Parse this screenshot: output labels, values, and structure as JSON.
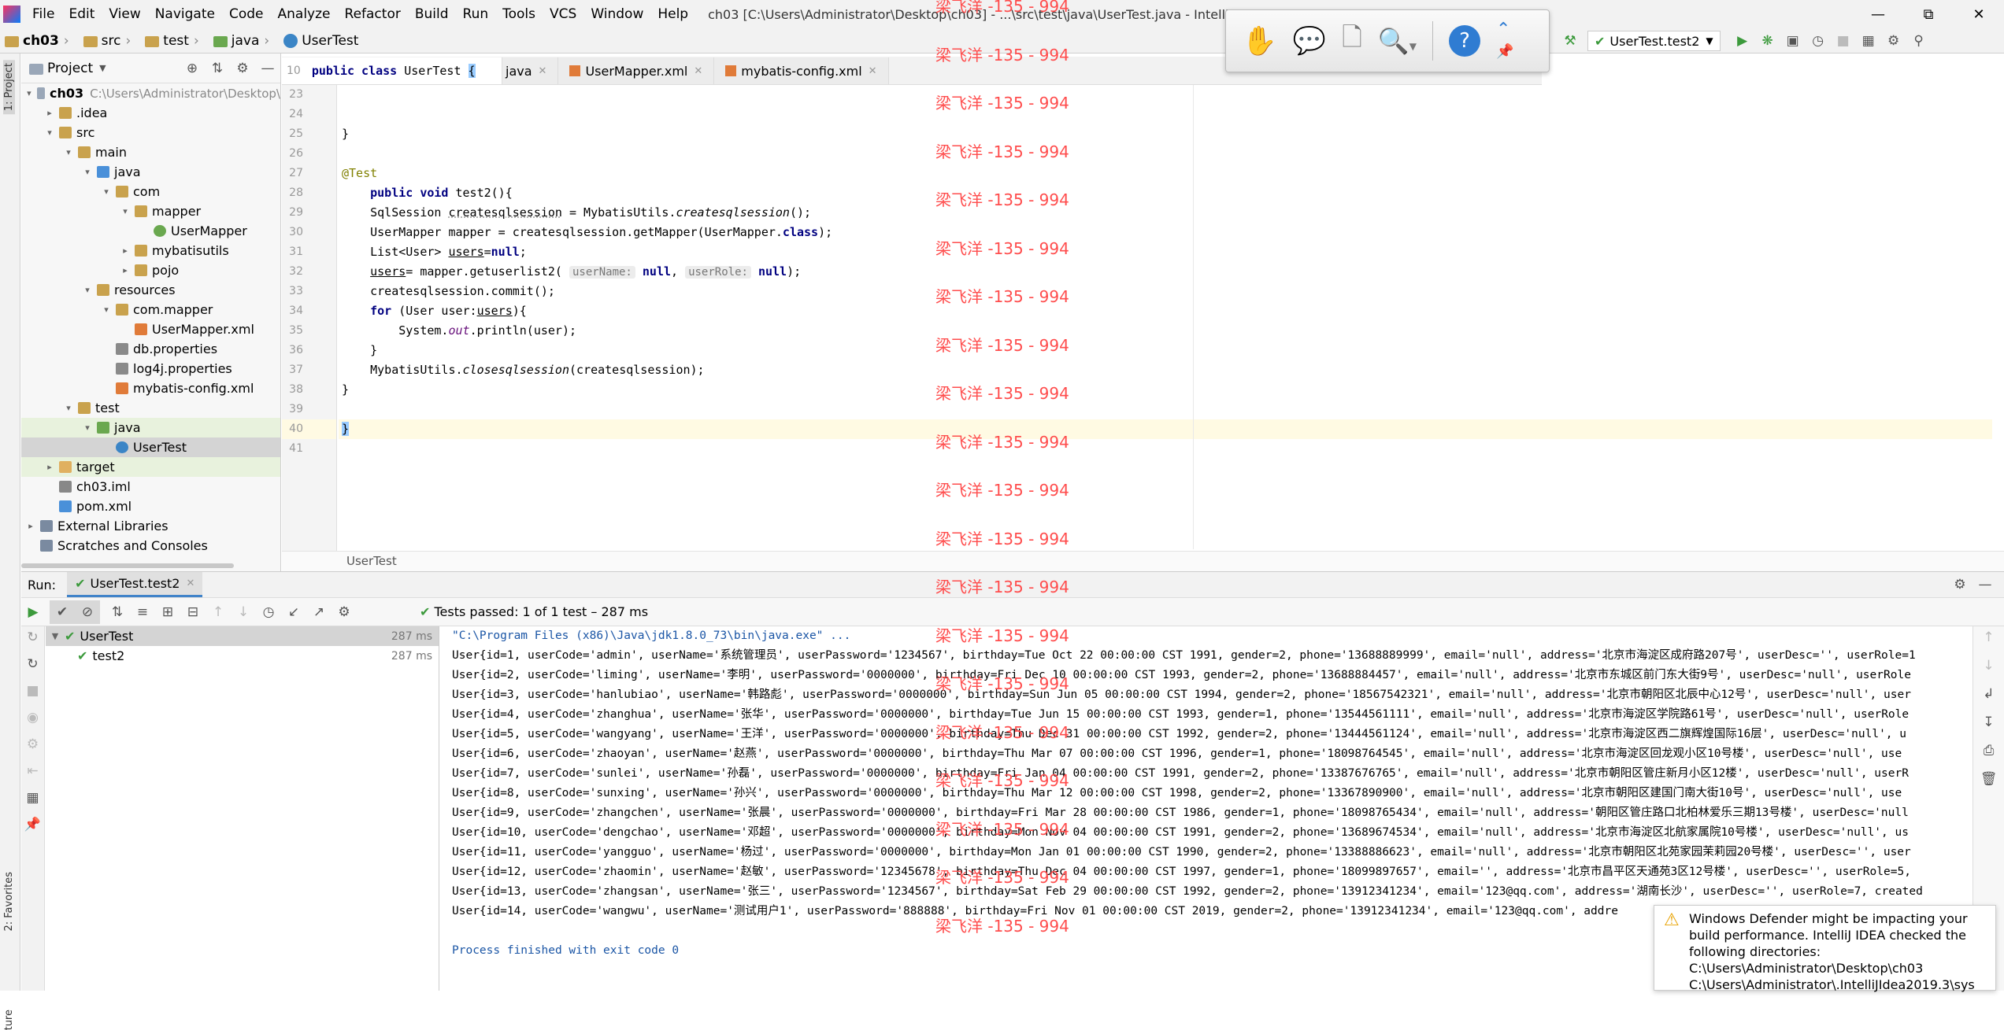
{
  "menubar": {
    "items": [
      "File",
      "Edit",
      "View",
      "Navigate",
      "Code",
      "Analyze",
      "Refactor",
      "Build",
      "Run",
      "Tools",
      "VCS",
      "Window",
      "Help"
    ],
    "title": "ch03 [C:\\Users\\Administrator\\Desktop\\ch03] - ...\\src\\test\\java\\UserTest.java - IntelliJ IDEA (Administrator)"
  },
  "navbar": {
    "crumbs": [
      "ch03",
      "src",
      "test",
      "java",
      "UserTest"
    ]
  },
  "runconfig": {
    "name": "UserTest.test2"
  },
  "project": {
    "header": "Project",
    "tree": [
      {
        "label": "ch03",
        "extra": "C:\\Users\\Administrator\\Desktop\\",
        "depth": 0,
        "open": "down",
        "kind": "module"
      },
      {
        "label": ".idea",
        "depth": 1,
        "open": "right",
        "kind": "folder"
      },
      {
        "label": "src",
        "depth": 1,
        "open": "down",
        "kind": "folder"
      },
      {
        "label": "main",
        "depth": 2,
        "open": "down",
        "kind": "folder"
      },
      {
        "label": "java",
        "depth": 3,
        "open": "down",
        "kind": "src"
      },
      {
        "label": "com",
        "depth": 4,
        "open": "down",
        "kind": "folder"
      },
      {
        "label": "mapper",
        "depth": 5,
        "open": "down",
        "kind": "folder"
      },
      {
        "label": "UserMapper",
        "depth": 6,
        "open": "",
        "kind": "iface"
      },
      {
        "label": "mybatisutils",
        "depth": 5,
        "open": "right",
        "kind": "folder"
      },
      {
        "label": "pojo",
        "depth": 5,
        "open": "right",
        "kind": "folder"
      },
      {
        "label": "resources",
        "depth": 3,
        "open": "down",
        "kind": "res"
      },
      {
        "label": "com.mapper",
        "depth": 4,
        "open": "down",
        "kind": "folder"
      },
      {
        "label": "UserMapper.xml",
        "depth": 5,
        "open": "",
        "kind": "xml"
      },
      {
        "label": "db.properties",
        "depth": 4,
        "open": "",
        "kind": "prop"
      },
      {
        "label": "log4j.properties",
        "depth": 4,
        "open": "",
        "kind": "prop"
      },
      {
        "label": "mybatis-config.xml",
        "depth": 4,
        "open": "",
        "kind": "xml"
      },
      {
        "label": "test",
        "depth": 2,
        "open": "down",
        "kind": "folder"
      },
      {
        "label": "java",
        "depth": 3,
        "open": "down",
        "kind": "testsrc",
        "hl": true
      },
      {
        "label": "UserTest",
        "depth": 4,
        "open": "",
        "kind": "class",
        "sel": true
      },
      {
        "label": "target",
        "depth": 1,
        "open": "right",
        "kind": "target",
        "hl": true
      },
      {
        "label": "ch03.iml",
        "depth": 1,
        "open": "",
        "kind": "iml"
      },
      {
        "label": "pom.xml",
        "depth": 1,
        "open": "",
        "kind": "pom"
      },
      {
        "label": "External Libraries",
        "depth": 0,
        "open": "right",
        "kind": "lib"
      },
      {
        "label": "Scratches and Consoles",
        "depth": 0,
        "open": "",
        "kind": "scratch"
      }
    ]
  },
  "editor": {
    "tabs": [
      {
        "label": "java",
        "active": false
      },
      {
        "label": "UserMapper.xml",
        "active": false
      },
      {
        "label": "mybatis-config.xml",
        "active": false
      }
    ],
    "sticky": {
      "line": "10",
      "text": "public class UserTest {"
    },
    "lines": [
      "23",
      "24",
      "25",
      "26",
      "27",
      "28",
      "29",
      "30",
      "31",
      "32",
      "33",
      "34",
      "35",
      "36",
      "37",
      "38",
      "39",
      "40",
      "41"
    ],
    "code": {
      "l25": "}",
      "l27": "@Test",
      "l28_kw": "public void",
      "l28": " test2(){",
      "l29a": "SqlSession ",
      "l29b": "createsqlsession",
      "l29c": " = MybatisUtils.",
      "l29d": "createsqlsession",
      "l29e": "();",
      "l30a": "UserMapper mapper = createsqlsession.getMapper(UserMapper.",
      "l30kw": "class",
      "l30b": ");",
      "l31a": "List<User> ",
      "l31b": "users",
      "l31c": "=",
      "l31kw": "null",
      "l31d": ";",
      "l32a": "users",
      "l32b": "= mapper.getuserlist2(",
      "l32h1": "userName:",
      "l32n1": "null",
      "l32c": ", ",
      "l32h2": "userRole:",
      "l32n2": "null",
      "l32d": ");",
      "l33": "createsqlsession.commit();",
      "l34kw": "for",
      "l34a": " (User user:",
      "l34b": "users",
      "l34c": "){",
      "l35a": "System.",
      "l35b": "out",
      "l35c": ".println(user);",
      "l36": "}",
      "l37a": "MybatisUtils.",
      "l37b": "closesqlsession",
      "l37c": "(createsqlsession);",
      "l38": "}",
      "l40": "}"
    },
    "breadcrumb": "UserTest"
  },
  "run": {
    "label": "Run:",
    "tab": "UserTest.test2",
    "status": "Tests passed: 1 of 1 test – 287 ms",
    "tree": [
      {
        "label": "UserTest",
        "time": "287 ms"
      },
      {
        "label": "test2",
        "time": "287 ms"
      }
    ],
    "console": [
      "\"C:\\Program Files (x86)\\Java\\jdk1.8.0_73\\bin\\java.exe\" ...",
      "User{id=1, userCode='admin', userName='系统管理员', userPassword='1234567', birthday=Tue Oct 22 00:00:00 CST 1991, gender=2, phone='13688889999', email='null', address='北京市海淀区成府路207号', userDesc='', userRole=1",
      "User{id=2, userCode='liming', userName='李明', userPassword='0000000', birthday=Fri Dec 10 00:00:00 CST 1993, gender=2, phone='13688884457', email='null', address='北京市东城区前门东大街9号', userDesc='null', userRole",
      "User{id=3, userCode='hanlubiao', userName='韩路彪', userPassword='0000000', birthday=Sun Jun 05 00:00:00 CST 1994, gender=2, phone='18567542321', email='null', address='北京市朝阳区北辰中心12号', userDesc='null', user",
      "User{id=4, userCode='zhanghua', userName='张华', userPassword='0000000', birthday=Tue Jun 15 00:00:00 CST 1993, gender=1, phone='13544561111', email='null', address='北京市海淀区学院路61号', userDesc='null', userRole",
      "User{id=5, userCode='wangyang', userName='王洋', userPassword='0000000', birthday=Thu Dec 31 00:00:00 CST 1992, gender=2, phone='13444561124', email='null', address='北京市海淀区西二旗辉煌国际16层', userDesc='null', u",
      "User{id=6, userCode='zhaoyan', userName='赵燕', userPassword='0000000', birthday=Thu Mar 07 00:00:00 CST 1996, gender=1, phone='18098764545', email='null', address='北京市海淀区回龙观小区10号楼', userDesc='null', use",
      "User{id=7, userCode='sunlei', userName='孙磊', userPassword='0000000', birthday=Fri Jan 04 00:00:00 CST 1991, gender=2, phone='13387676765', email='null', address='北京市朝阳区管庄新月小区12楼', userDesc='null', userR",
      "User{id=8, userCode='sunxing', userName='孙兴', userPassword='0000000', birthday=Thu Mar 12 00:00:00 CST 1998, gender=2, phone='13367890900', email='null', address='北京市朝阳区建国门南大街10号', userDesc='null', use",
      "User{id=9, userCode='zhangchen', userName='张晨', userPassword='0000000', birthday=Fri Mar 28 00:00:00 CST 1986, gender=1, phone='18098765434', email='null', address='朝阳区管庄路口北柏林爱乐三期13号楼', userDesc='null",
      "User{id=10, userCode='dengchao', userName='邓超', userPassword='0000000', birthday=Mon Nov 04 00:00:00 CST 1991, gender=2, phone='13689674534', email='null', address='北京市海淀区北航家属院10号楼', userDesc='null', us",
      "User{id=11, userCode='yangguo', userName='杨过', userPassword='0000000', birthday=Mon Jan 01 00:00:00 CST 1990, gender=2, phone='13388886623', email='null', address='北京市朝阳区北苑家园茉莉园20号楼', userDesc='', user",
      "User{id=12, userCode='zhaomin', userName='赵敏', userPassword='12345678', birthday=Thu Dec 04 00:00:00 CST 1997, gender=1, phone='18099897657', email='', address='北京市昌平区天通苑3区12号楼', userDesc='', userRole=5,",
      "User{id=13, userCode='zhangsan', userName='张三', userPassword='1234567', birthday=Sat Feb 29 00:00:00 CST 1992, gender=2, phone='13912341234', email='123@qq.com', address='湖南长沙', userDesc='', userRole=7, created",
      "User{id=14, userCode='wangwu', userName='测试用户1', userPassword='888888', birthday=Fri Nov 01 00:00:00 CST 2019, gender=2, phone='13912341234', email='123@qq.com', addre",
      "",
      "Process finished with exit code 0"
    ]
  },
  "notification": {
    "text": "Windows Defender might be impacting your build performance. IntelliJ IDEA checked the following directories:",
    "dirs": [
      "C:\\Users\\Administrator\\Desktop\\ch03",
      "C:\\Users\\Administrator\\.IntelliJIdea2019.3\\sys"
    ]
  },
  "watermark": {
    "text": "梁飞洋 -135 - 994",
    "count": 20
  },
  "leftstrip": {
    "project": "1: Project",
    "favorites": "2: Favorites",
    "structure": "ture"
  },
  "colors": {
    "accent": "#3c9a3c",
    "watermark": "#ff4d4d",
    "keyword": "#000080",
    "annotation": "#808000",
    "field": "#660e7a"
  }
}
